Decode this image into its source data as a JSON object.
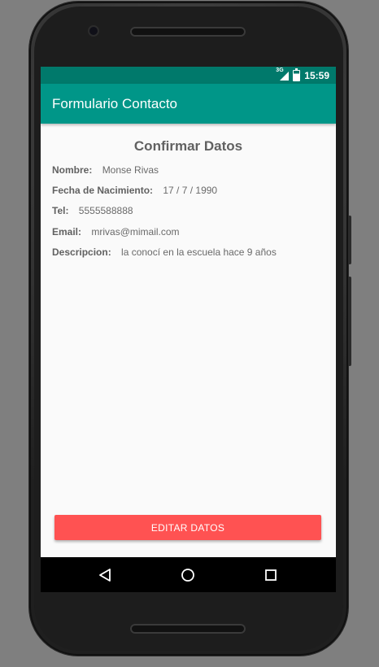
{
  "status_bar": {
    "network_label": "3G",
    "time": "15:59"
  },
  "app_bar": {
    "title": "Formulario Contacto"
  },
  "screen": {
    "heading": "Confirmar Datos",
    "fields": [
      {
        "label": "Nombre:",
        "value": "Monse Rivas"
      },
      {
        "label": "Fecha de Nacimiento:",
        "value": "17 / 7 / 1990"
      },
      {
        "label": "Tel:",
        "value": "5555588888"
      },
      {
        "label": "Email:",
        "value": "mrivas@mimail.com"
      },
      {
        "label": "Descripcion:",
        "value": "la conocí en la escuela hace 9 años"
      }
    ],
    "edit_button_label": "EDITAR DATOS"
  },
  "nav_bar": {
    "back_icon": "back-triangle-icon",
    "home_icon": "home-circle-icon",
    "recents_icon": "recents-square-icon"
  },
  "colors": {
    "status_bar": "#00796b",
    "app_bar": "#009688",
    "accent_button": "#ff5252",
    "screen_background": "#fafafa"
  }
}
